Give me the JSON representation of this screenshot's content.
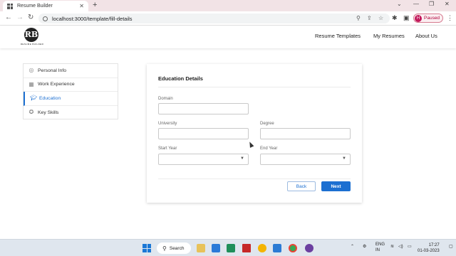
{
  "browser": {
    "tab_title": "Resume Builder",
    "url": "localhost:3000/template/fill-details",
    "profile_initial": "H",
    "profile_status": "Paused"
  },
  "app": {
    "logo_mark": "RB",
    "logo_caption": "RESUME BUILDER",
    "nav": [
      "Resume Templates",
      "My Resumes",
      "About Us"
    ]
  },
  "sidebar": {
    "items": [
      {
        "label": "Personal Info",
        "icon": "user-circle-icon"
      },
      {
        "label": "Work Experience",
        "icon": "building-icon"
      },
      {
        "label": "Education",
        "icon": "graduation-cap-icon",
        "active": true
      },
      {
        "label": "Key Skills",
        "icon": "star-circle-icon"
      }
    ]
  },
  "form": {
    "title": "Education Details",
    "domain_label": "Domain",
    "university_label": "University",
    "degree_label": "Degree",
    "start_year_label": "Start Year",
    "end_year_label": "End Year",
    "back_label": "Back",
    "next_label": "Next"
  },
  "taskbar": {
    "search_label": "Search",
    "lang_top": "ENG",
    "lang_bottom": "IN",
    "time": "17:27",
    "date": "01-03-2023"
  },
  "colors": {
    "accent": "#1c6fd1",
    "tabbar": "#f2e3e6",
    "taskbar": "#dfe6ee"
  }
}
